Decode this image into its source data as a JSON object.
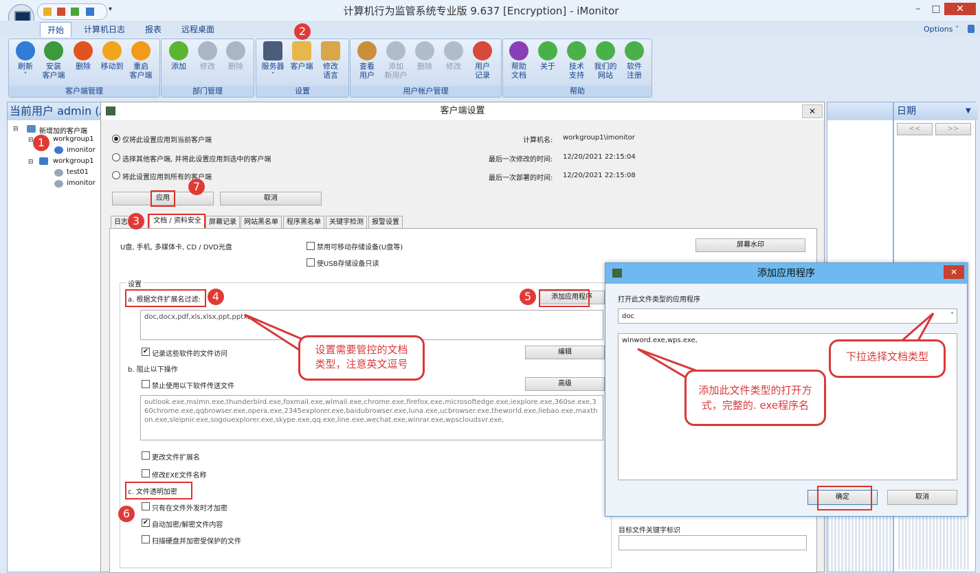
{
  "window": {
    "title": "计算机行为监管系统专业版 9.637 [Encryption] - iMonitor",
    "min": "–",
    "max": "□",
    "close": "✕"
  },
  "menu": {
    "tabs": [
      "开始",
      "计算机日志",
      "报表",
      "远程桌面"
    ],
    "options": "Options ˅"
  },
  "ribbon": {
    "groups": [
      "客户端管理",
      "部门管理",
      "设置",
      "用户帐户管理",
      "帮助"
    ],
    "buttons": [
      {
        "label": "刷新\n˅",
        "color": "#2f7dd6"
      },
      {
        "label": "安装\n客户端",
        "color": "#3b9a3b"
      },
      {
        "label": "删除",
        "color": "#e2541f"
      },
      {
        "label": "移动到",
        "color": "#f2a51a"
      },
      {
        "label": "重启\n客户端",
        "color": "#f29a1a"
      },
      {
        "label": "添加",
        "color": "#5cb532"
      },
      {
        "label": "修改",
        "color": "#aab6c6"
      },
      {
        "label": "删除",
        "color": "#aab6c6"
      },
      {
        "label": "服务器\n˅",
        "color": "#4a5d7a"
      },
      {
        "label": "客户端",
        "color": "#e8b64a"
      },
      {
        "label": "修改\n语言",
        "color": "#d9a64a"
      },
      {
        "label": "查看\n用户",
        "color": "#c8903a"
      },
      {
        "label": "添加\n新用户",
        "color": "#b0bccb"
      },
      {
        "label": "删除",
        "color": "#b0bccb"
      },
      {
        "label": "修改",
        "color": "#b0bccb"
      },
      {
        "label": "用户\n记录",
        "color": "#d74a3a"
      },
      {
        "label": "帮助\n文档",
        "color": "#8a3fb6"
      },
      {
        "label": "关于",
        "color": "#4ab14a"
      },
      {
        "label": "技术\n支持",
        "color": "#4ab14a"
      },
      {
        "label": "我们的\n网站",
        "color": "#4ab14a"
      },
      {
        "label": "软件\n注册",
        "color": "#4ab14a"
      }
    ]
  },
  "left_panel": {
    "header": "当前用户 admin (A",
    "tree": [
      "新增加的客户端",
      "workgroup1",
      "imonitor",
      "workgroup1",
      "test01",
      "imonitor"
    ]
  },
  "dialog": {
    "title": "客户端设置",
    "close": "✕",
    "radios": [
      "仅将此设置应用到当前客户端",
      "选择其他客户端, 并将此设置应用到选中的客户端",
      "将此设置应用到所有的客户端"
    ],
    "info_labels": [
      "计算机名:",
      "最后一次修改的时间:",
      "最后一次部署的时间:"
    ],
    "info_values": [
      "workgroup1\\imonitor",
      "12/20/2021 22:15:04",
      "12/20/2021 22:15:08"
    ],
    "apply": "应用",
    "cancel": "取消",
    "tabs": [
      "日志",
      "文档 / 资料安全",
      "屏幕记录",
      "网站黑名单",
      "程序黑名单",
      "关键字检测",
      "报警设置"
    ],
    "media_label": "U盘, 手机, 多媒体卡, CD / DVD光盘",
    "disable_storage": "禁用可移动存储设备(U盘等)",
    "usb_readonly": "使USB存储设备只读",
    "watermark": "屏幕水印",
    "settings_group": "设置",
    "filter_label": "a. 根据文件扩展名过滤:",
    "add_app": "添加应用程序",
    "ext_value": "doc,docx,pdf,xls,xlsx,ppt,pptx,",
    "record_access": "记录这些软件的文件访问",
    "edit": "编辑",
    "block_label": "b. 阻止以下操作",
    "forbid_send": "禁止使用以下软件传送文件",
    "advanced": "高级",
    "apps_list": "outlook.exe,msimn.exe,thunderbird.exe,foxmail.exe,wlmail.exe,chrome.exe,firefox.exe,microsoftedge.exe,iexplore.exe,360se.exe,360chrome.exe,qqbrowser.exe,opera.exe,2345explorer.exe,baidubrowser.exe,luna.exe,ucbrowser.exe,theworld.exe,liebao.exe,maxthon.exe,sleipnir.exe,sogouexplorer.exe,skype.exe,qq.exe,line.exe,wechat.exe,winrar.exe,wpscloudsvr.exe,",
    "change_ext": "更改文件扩展名",
    "rename_exe": "修改EXE文件名称",
    "encrypt_label": "c. 文件透明加密",
    "encrypt_on_send": "只有在文件外发时才加密",
    "auto_encrypt": "自动加密/解密文件内容",
    "scan_disk": "扫描硬盘并加密受保护的文件",
    "keyword_label": "目标文件关键字标识"
  },
  "calendar": {
    "header": "日期",
    "prev": "<<",
    "next": ">>"
  },
  "dialog2": {
    "title": "添加应用程序",
    "close": "✕",
    "open_label": "打开此文件类型的应用程序",
    "select_value": "doc",
    "apps_value": "winword.exe,wps.exe,",
    "ok": "确定",
    "cancel": "取消"
  },
  "callouts": {
    "c1": "设置需要管控的文档\n类型，注意英文逗号",
    "c2": "下拉选择文档类型",
    "c3": "添加此文件类型的打开方\n式，完整的. exe程序名"
  },
  "badges": [
    "1",
    "2",
    "3",
    "4",
    "5",
    "6",
    "7"
  ]
}
